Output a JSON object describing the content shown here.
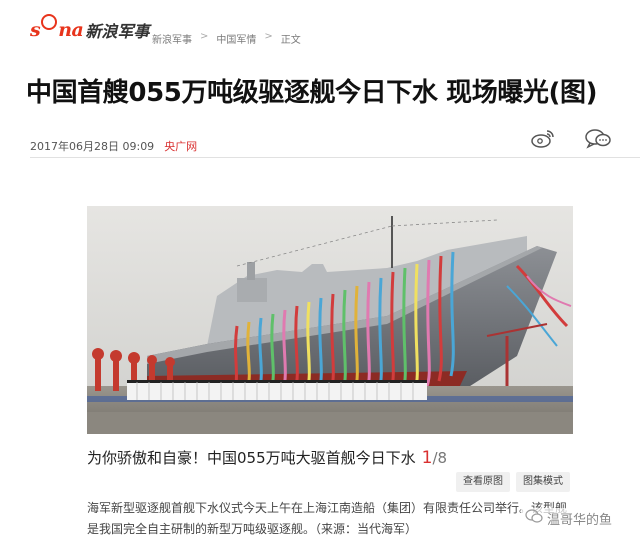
{
  "header": {
    "logo_text": "sina",
    "logo_name": "新浪军事",
    "breadcrumb": [
      "新浪军事",
      "中国军情",
      "正文"
    ],
    "breadcrumb_sep": ">"
  },
  "article": {
    "title": "中国首艘055万吨级驱逐舰今日下水 现场曝光(图)",
    "date": "2017年06月28日 09:09",
    "source": "央广网"
  },
  "gallery": {
    "caption": "为你骄傲和自豪！中国055万吨大驱首舰今日下水",
    "current": "1",
    "total": "/8",
    "view_original_label": "查看原图",
    "gallery_mode_label": "图集模式",
    "description": "海军新型驱逐舰首舰下水仪式今天上午在上海江南造船（集团）有限责任公司举行。该型舰是我国完全自主研制的新型万吨级驱逐舰。（来源：当代海军）"
  },
  "watermark": {
    "text": "温哥华的鱼"
  },
  "icons": {
    "share": "weibo-icon",
    "comment": "comment-icon"
  },
  "colors": {
    "accent": "#d93030",
    "logo": "#e8341c"
  }
}
